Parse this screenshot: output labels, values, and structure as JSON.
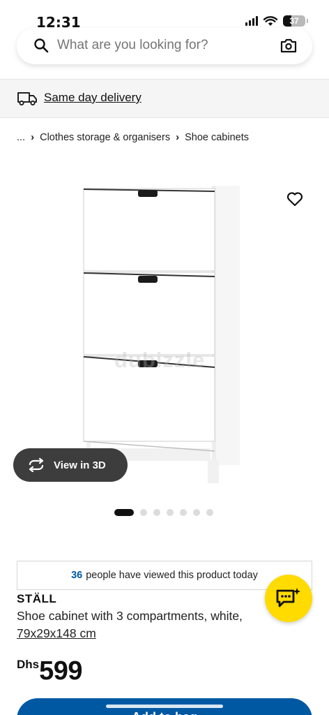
{
  "status": {
    "time": "12:31",
    "battery": "37"
  },
  "search": {
    "placeholder": "What are you looking for?"
  },
  "delivery": {
    "label": "Same day delivery"
  },
  "breadcrumb": {
    "items": [
      "...",
      "Clothes storage & organisers",
      "Shoe cabinets"
    ]
  },
  "gallery": {
    "watermark": "dubizzle",
    "view3d_label": "View in 3D",
    "dot_count": 7,
    "active_dot": 0
  },
  "viewed": {
    "count": "36",
    "text": "people have viewed this product today"
  },
  "product": {
    "name": "STÄLL",
    "description": "Shoe cabinet with 3 compartments, white,",
    "dimensions": "79x29x148 cm",
    "currency": "Dhs",
    "price": "599"
  },
  "cta": {
    "label": "Add to bag"
  },
  "colors": {
    "accent_blue": "#0058a3",
    "chat_yellow": "#ffdb00",
    "pill_dark": "#3d3d3d"
  },
  "icons": [
    "search-icon",
    "camera-icon",
    "truck-icon",
    "heart-icon",
    "rotate-3d-icon",
    "chat-sparkle-icon",
    "signal-icon",
    "wifi-icon",
    "battery-icon"
  ]
}
